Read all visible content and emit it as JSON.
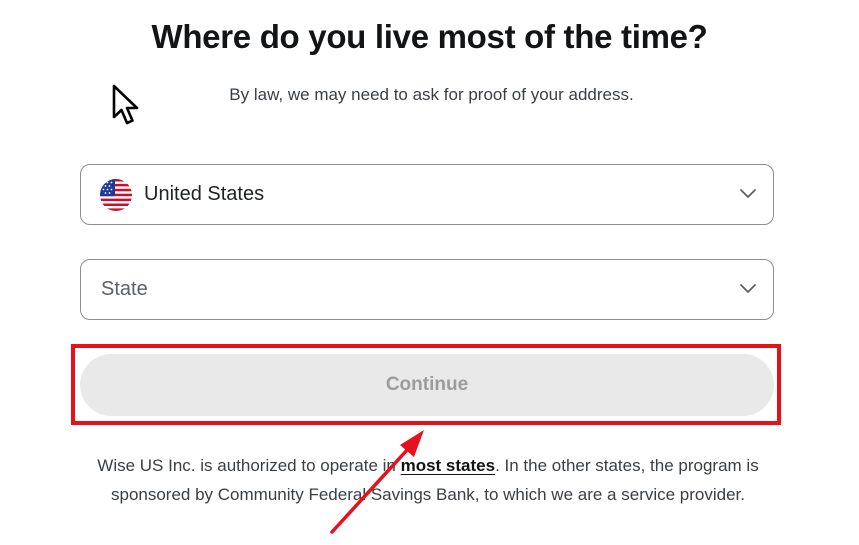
{
  "heading": "Where do you live most of the time?",
  "subheading": "By law, we may need to ask for proof of your address.",
  "country_select": {
    "value": "United States",
    "flag_icon": "us-flag-icon"
  },
  "state_select": {
    "placeholder": "State"
  },
  "continue_button": {
    "label": "Continue",
    "enabled": false
  },
  "footer": {
    "text_before": "Wise US Inc. is authorized to operate in ",
    "link": "most states",
    "text_after": ". In the other states, the program is sponsored by Community Federal Savings Bank, to which we are a service provider."
  },
  "colors": {
    "annotation_red": "#e8101a",
    "button_disabled_bg": "#e9e9e9",
    "button_disabled_text": "#9c9c9c"
  }
}
